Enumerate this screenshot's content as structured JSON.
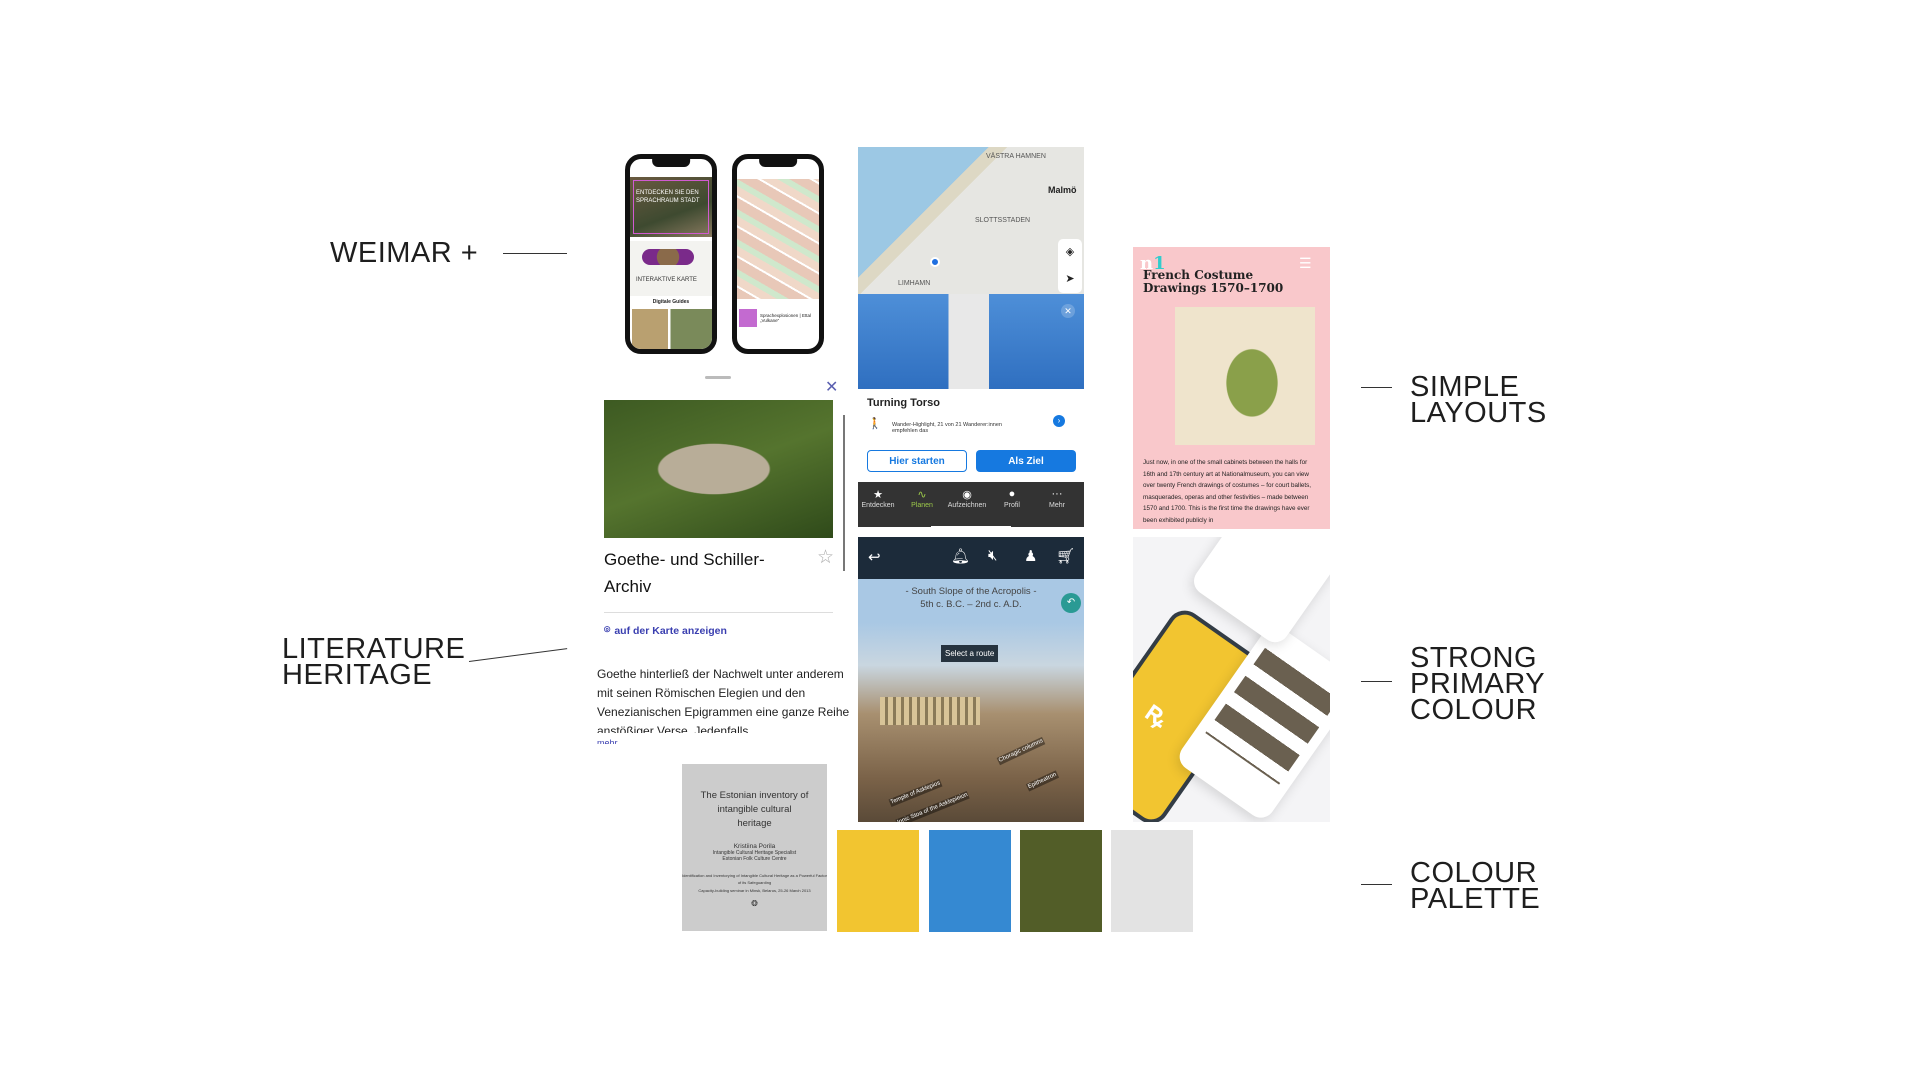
{
  "labels": {
    "weimar": "WEIMAR +",
    "literature": "LITERATURE HERITAGE",
    "simple": "SIMPLE LAYOUTS",
    "strong": "STRONG PRIMARY COLOUR",
    "palette": "COLOUR PALETTE"
  },
  "weimar": {
    "hero_title": "ENTDECKEN SIE DEN SPRACHRAUM STADT",
    "map_label": "INTERAKTIVE KARTE",
    "guides": "Digitale Guides",
    "popup": "Sprachexplosionen | Ettal „Vulkane“"
  },
  "goethe": {
    "title": "Goethe- und Schiller-Archiv",
    "map_link": "auf der Karte anzeigen",
    "body": "Goethe hinterließ der Nachwelt unter anderem mit seinen Römischen Elegien und den Venezianischen Epigrammen eine ganze Reihe anstößiger Verse. Jedenfalls",
    "more": "mehr"
  },
  "map": {
    "places": [
      "VÄSTRA HAMNEN",
      "Malmö",
      "SLOTTSSTADEN",
      "LIMHAMN"
    ],
    "poi_title": "Turning Torso",
    "poi_desc": "Wander-Highlight, 21 von 21 Wanderer:innen empfehlen das",
    "start": "Hier starten",
    "goal": "Als Ziel",
    "nav": [
      "Entdecken",
      "Planen",
      "Aufzeichnen",
      "Profil",
      "Mehr"
    ],
    "active_nav": "Planen"
  },
  "acropolis": {
    "title_line1": "- South Slope of the Acropolis -",
    "title_line2": "5th c. B.C. – 2nd c. A.D.",
    "select": "Select a route",
    "tags": [
      "Temple of Asklepios",
      "Ionic Stoa of the Asklepieion",
      "Choragic columns",
      "Epitheatron"
    ]
  },
  "french": {
    "title": "French Costume Drawings 1570–1700",
    "body": "Just now, in one of the small cabinets between the halls for 16th and 17th century art at Nationalmuseum, you can view over twenty French drawings of costumes – for court ballets, masquerades, operas and other festivities – made between 1570 and 1700. This is the first time the drawings have ever been exhibited publicly in"
  },
  "estonian": {
    "title": "The Estonian inventory of intangible cultural heritage",
    "author": "Kristiina Porila",
    "role": "Intangible Cultural Heritage Specialist",
    "org": "Estonian Folk Culture Centre",
    "talk": "Identification and Inventorying of Intangible Cultural Heritage as a Powerful Factor of its Safeguarding",
    "event": "Capacity-building seminar in Minsk, Belarus, 25-26 March 2013"
  },
  "palette": [
    "#f2c530",
    "#3589d2",
    "#525d28",
    "#e3e3e3"
  ]
}
